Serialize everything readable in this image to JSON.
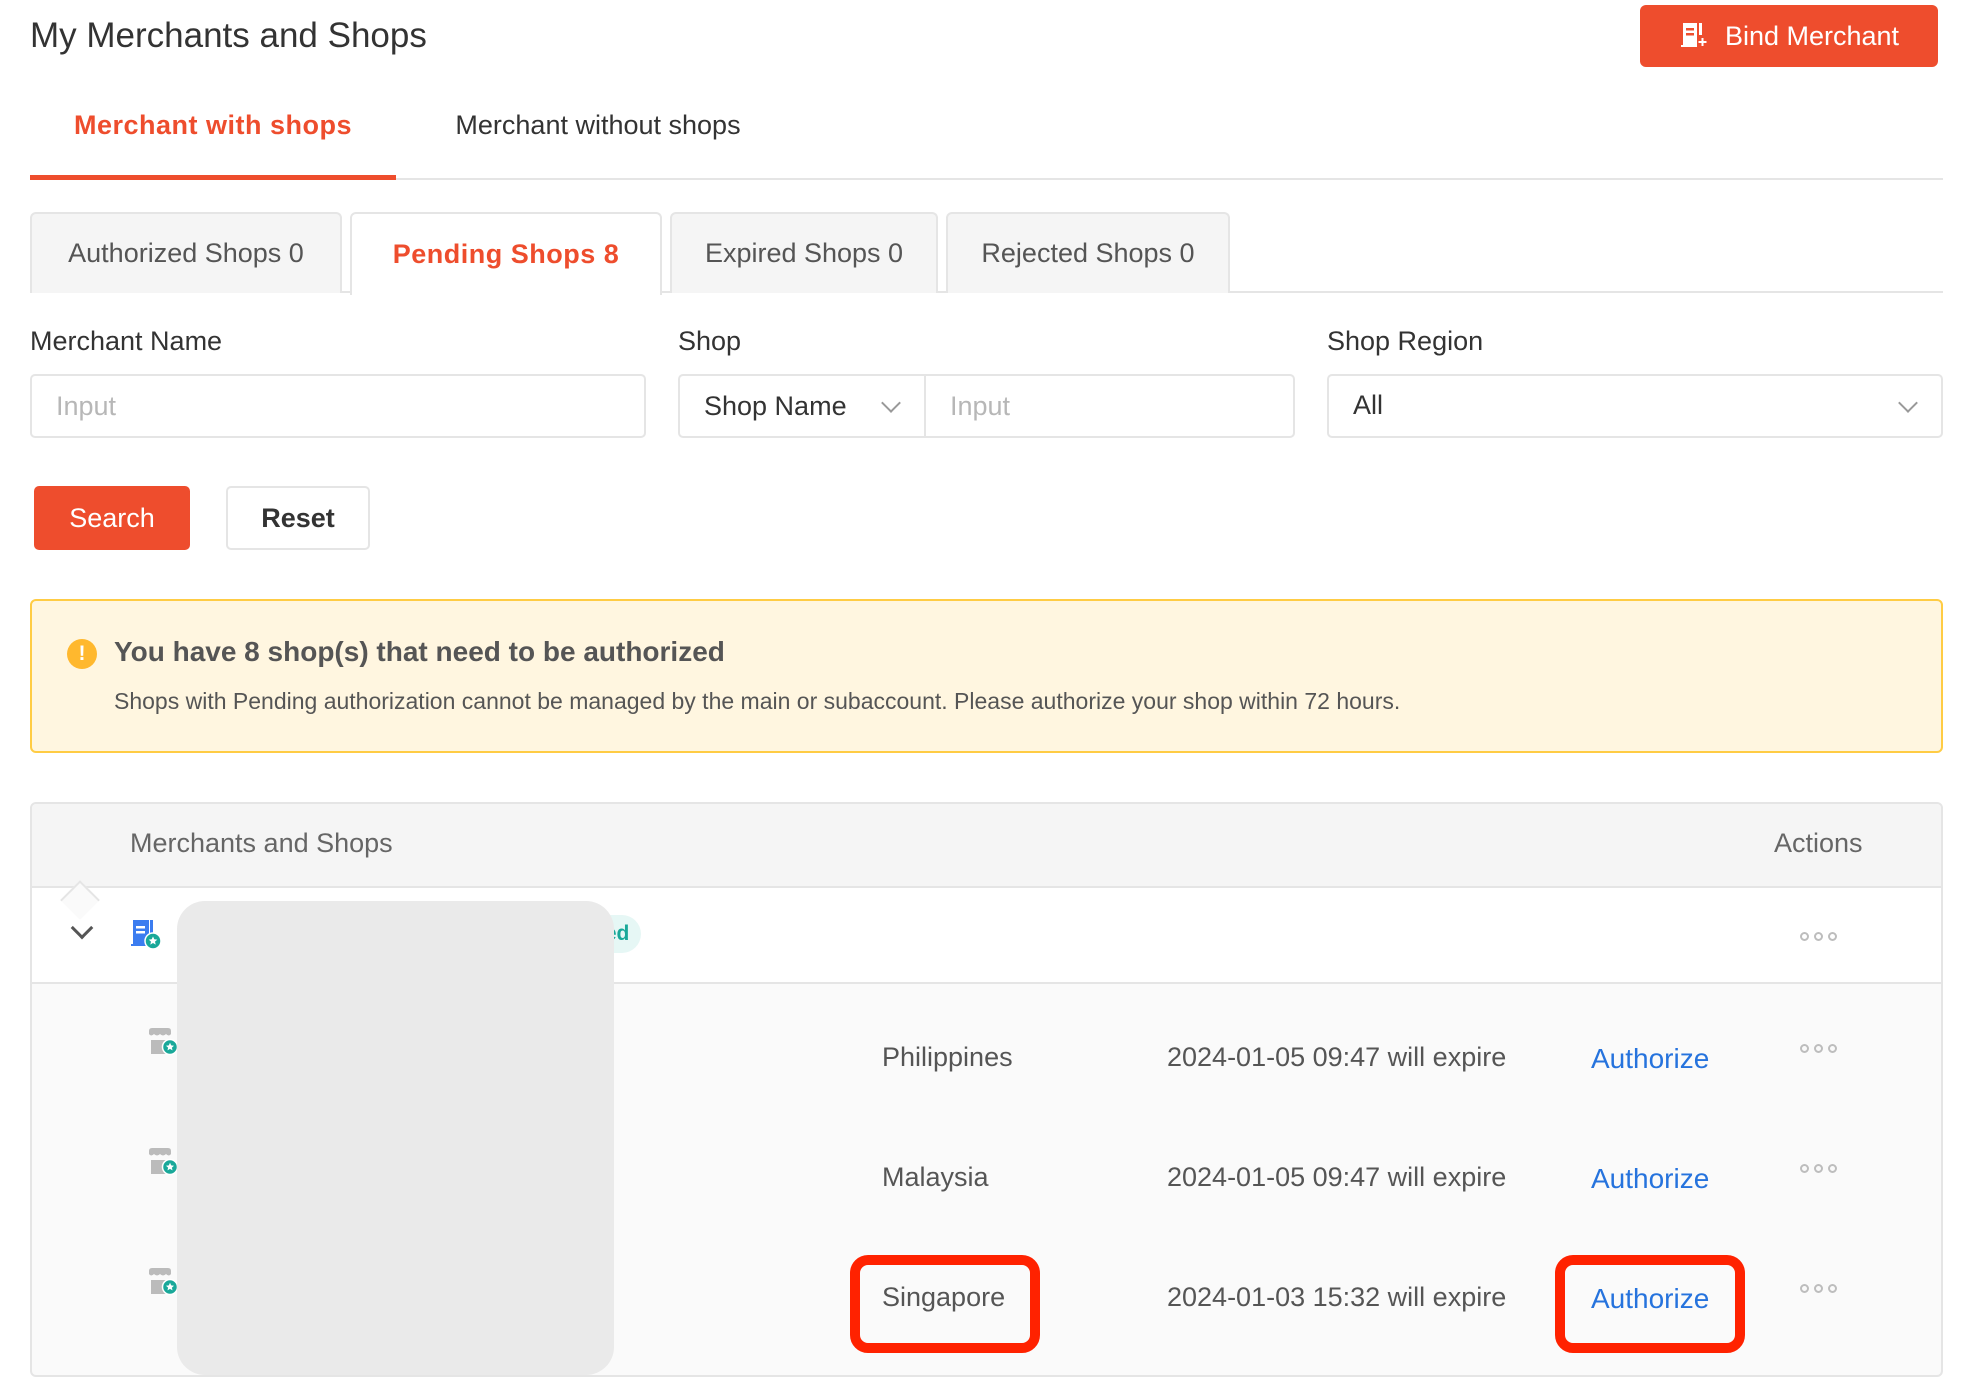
{
  "header": {
    "title": "My Merchants and Shops",
    "bind_merchant_label": "Bind Merchant",
    "bind_merchant_icon": "building-add-icon"
  },
  "main_tabs": [
    {
      "label": "Merchant with shops",
      "active": true
    },
    {
      "label": "Merchant without shops",
      "active": false
    }
  ],
  "sub_tabs": [
    {
      "label": "Authorized Shops 0",
      "active": false
    },
    {
      "label": "Pending Shops 8",
      "active": true
    },
    {
      "label": "Expired Shops 0",
      "active": false
    },
    {
      "label": "Rejected Shops 0",
      "active": false
    }
  ],
  "filters": {
    "merchant_name": {
      "label": "Merchant Name",
      "placeholder": "Input",
      "value": ""
    },
    "shop": {
      "label": "Shop",
      "select_value": "Shop Name",
      "placeholder": "Input",
      "value": ""
    },
    "shop_region": {
      "label": "Shop Region",
      "value": "All"
    },
    "search_label": "Search",
    "reset_label": "Reset"
  },
  "alert": {
    "icon": "warning-icon",
    "title": "You have 8 shop(s) that need to be authorized",
    "body": "Shops with Pending authorization cannot be managed by the main or subaccount. Please authorize your shop within 72 hours."
  },
  "table": {
    "columns": [
      "Merchants and Shops",
      "Actions"
    ],
    "merchant": {
      "name": "",
      "badge": "ded",
      "expanded": true
    },
    "shops": [
      {
        "region": "Philippines",
        "expire": "2024-01-05 09:47 will expire",
        "action": "Authorize"
      },
      {
        "region": "Malaysia",
        "expire": "2024-01-05 09:47 will expire",
        "action": "Authorize"
      },
      {
        "region": "Singapore",
        "expire": "2024-01-03 15:32 will expire",
        "action": "Authorize"
      }
    ]
  },
  "colors": {
    "brand": "#EE4D2D",
    "link": "#2673DD",
    "warning": "#FFB82E",
    "annotation": "#FF2200",
    "badge_text": "#19A899"
  }
}
